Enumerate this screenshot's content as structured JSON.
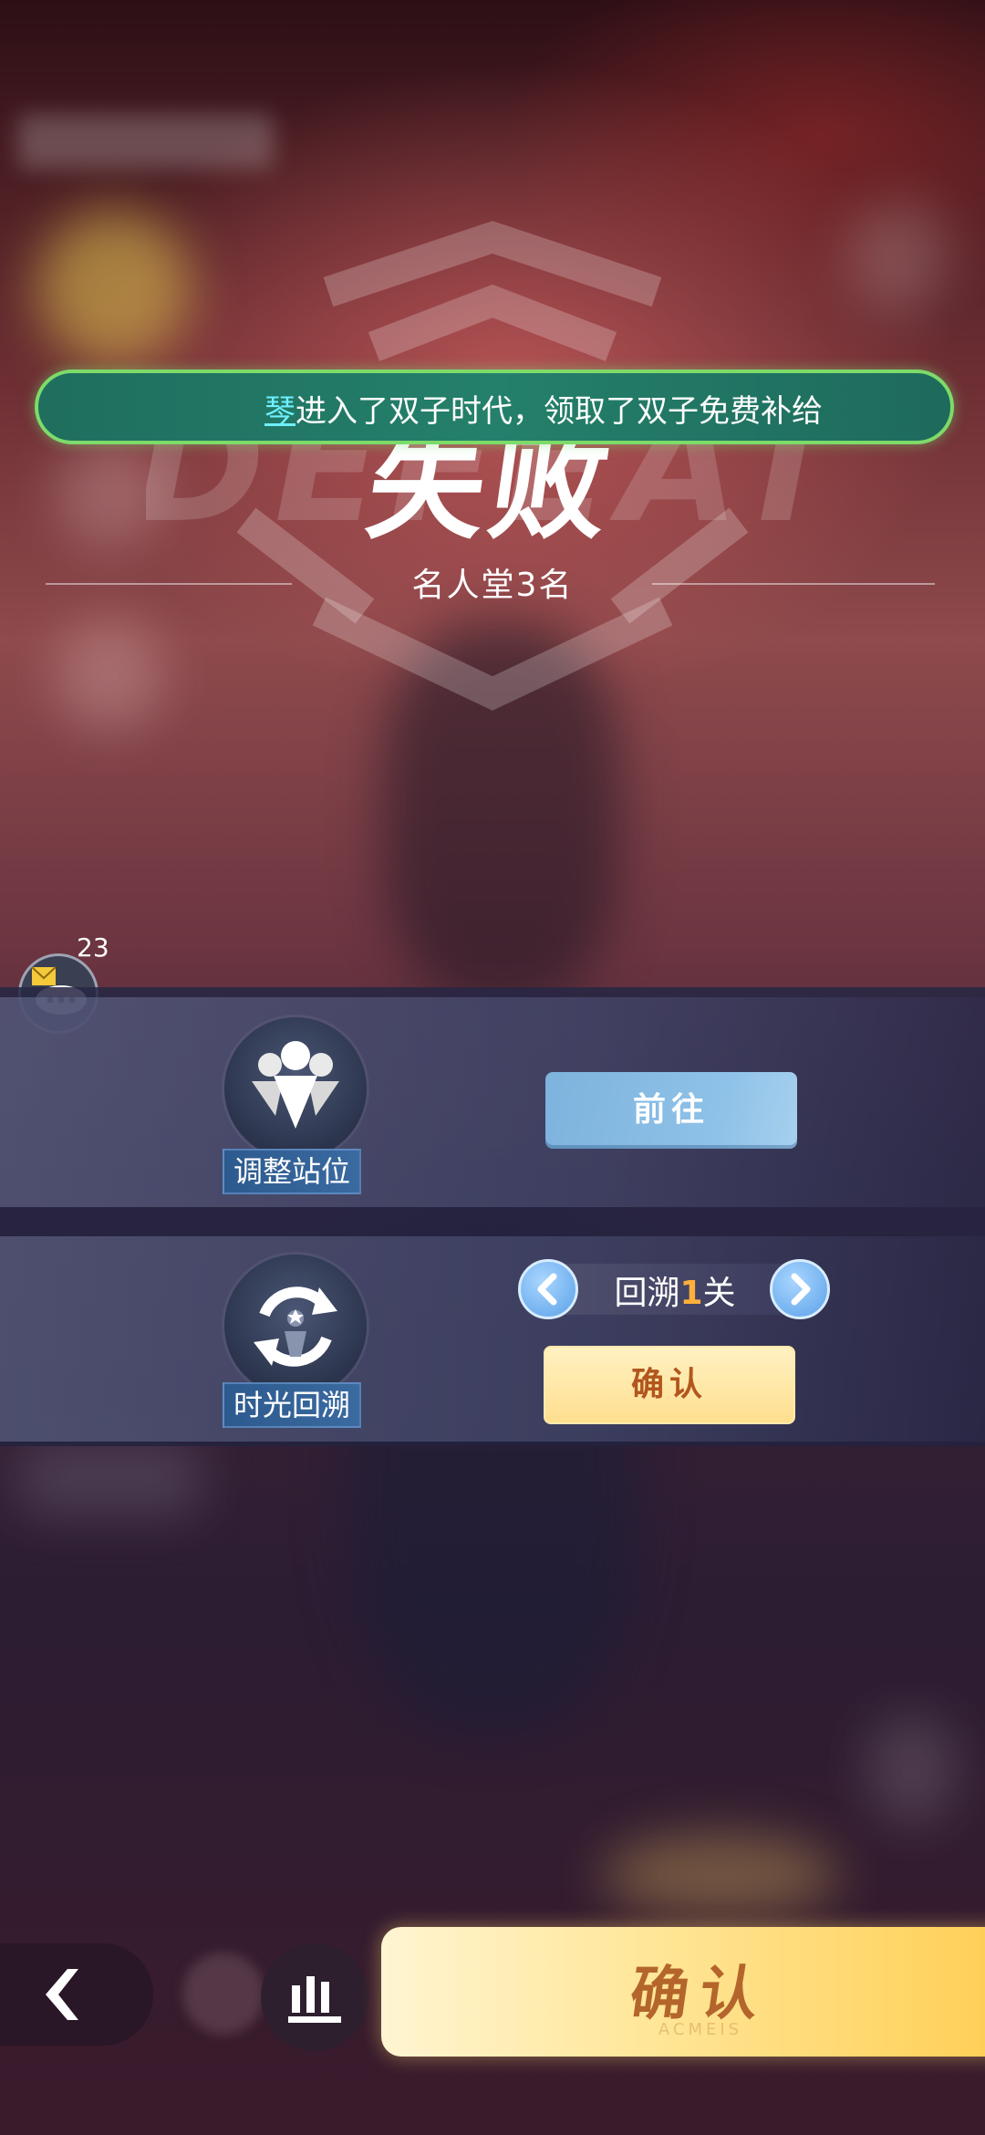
{
  "announcement": {
    "name": "琴",
    "text": "进入了双子时代，领取了双子免费补给"
  },
  "result": {
    "title": "失败",
    "rank": "名人堂3名"
  },
  "chat": {
    "count": "23"
  },
  "options": {
    "adjust": {
      "label": "调整站位",
      "button": "前往"
    },
    "rewind": {
      "label": "时光回溯",
      "prefix": "回溯",
      "levels": "1",
      "suffix": "关",
      "button": "确认"
    }
  },
  "footer": {
    "confirm": "确认",
    "watermark": "ACMEIS"
  },
  "colors": {
    "banner_border": "#7ddb6a",
    "highlight_number": "#ffb03a",
    "confirm_text": "#b4652c"
  }
}
